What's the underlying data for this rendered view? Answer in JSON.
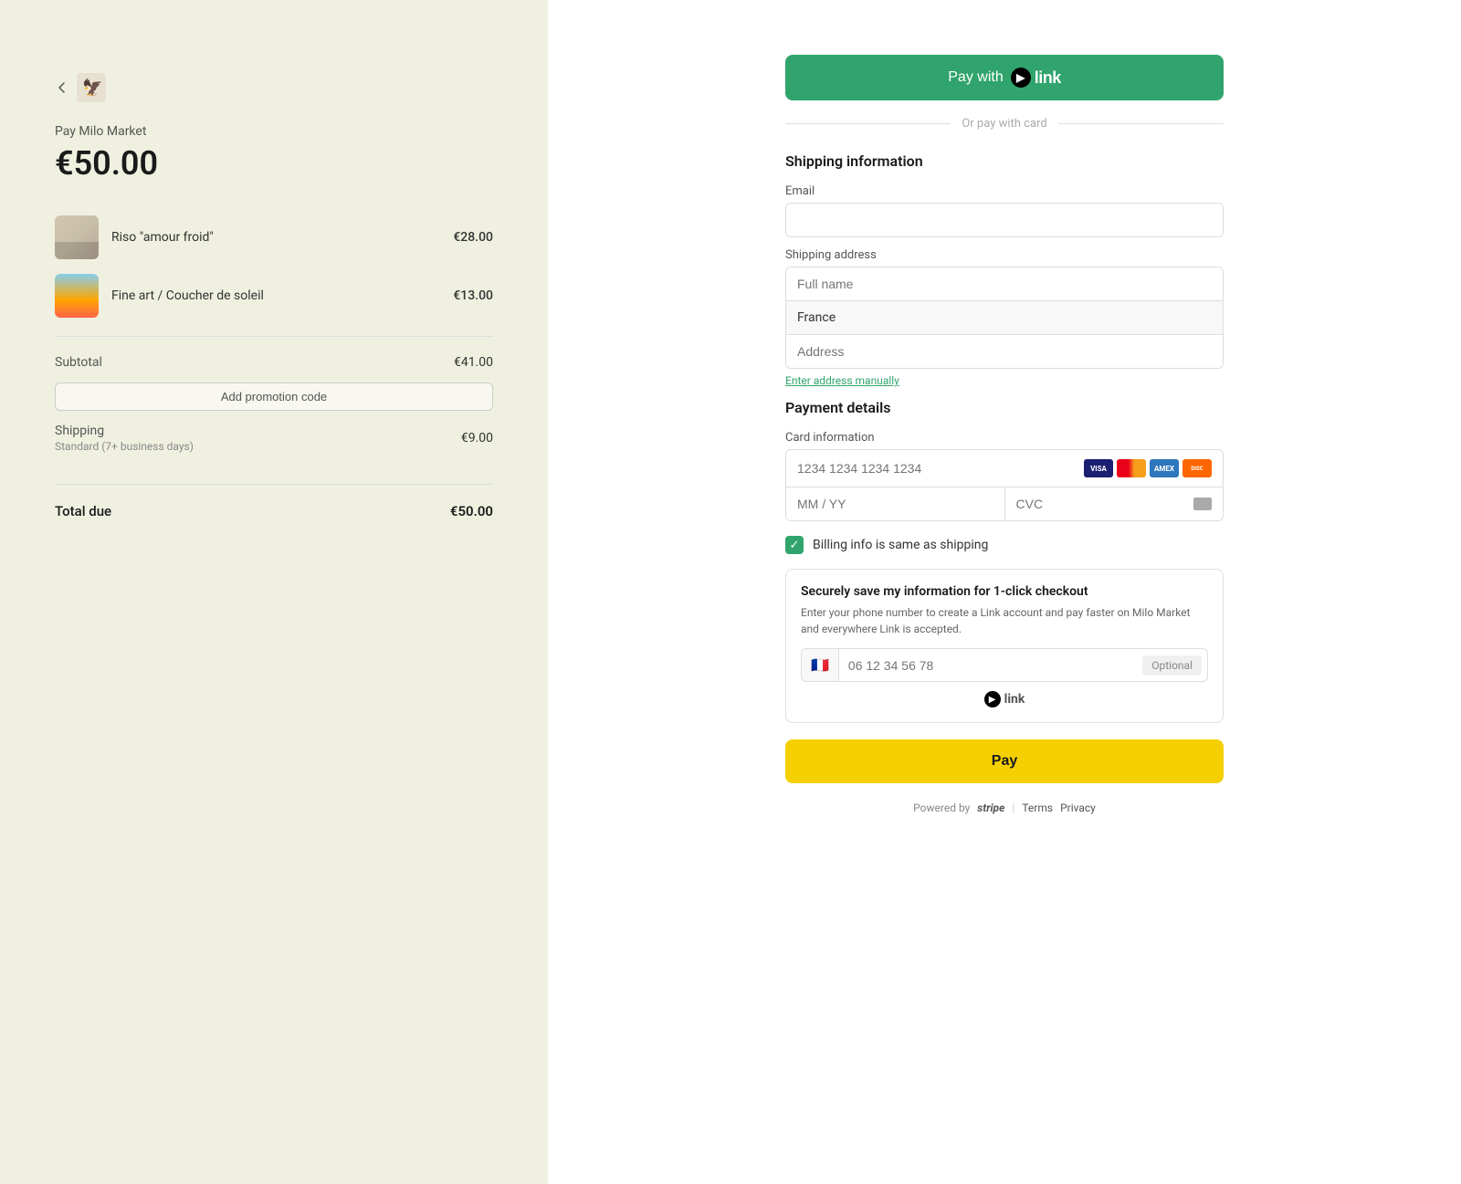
{
  "left": {
    "pay_label": "Pay Milo Market",
    "total_amount": "€50.00",
    "items": [
      {
        "name": "Riso \"amour froid\"",
        "price": "€28.00"
      },
      {
        "name": "Fine art / Coucher de soleil",
        "price": "€13.00"
      }
    ],
    "subtotal_label": "Subtotal",
    "subtotal_value": "€41.00",
    "promo_button": "Add promotion code",
    "shipping_label": "Shipping",
    "shipping_sublabel": "Standard (7+ business days)",
    "shipping_value": "€9.00",
    "total_label": "Total due",
    "total_value": "€50.00"
  },
  "right": {
    "pay_with_link_label": "Pay with",
    "link_text": "link",
    "or_pay_label": "Or pay with card",
    "shipping_section": "Shipping information",
    "email_label": "Email",
    "email_placeholder": "",
    "shipping_address_label": "Shipping address",
    "full_name_placeholder": "Full name",
    "country_value": "France",
    "address_placeholder": "Address",
    "enter_manually": "Enter address manually",
    "payment_section": "Payment details",
    "card_info_label": "Card information",
    "card_placeholder": "1234 1234 1234 1234",
    "expiry_placeholder": "MM / YY",
    "cvc_placeholder": "CVC",
    "billing_same_label": "Billing info is same as shipping",
    "save_info_title": "Securely save my information for 1-click checkout",
    "save_info_desc": "Enter your phone number to create a Link account and pay faster on Milo Market and everywhere Link is accepted.",
    "phone_flag": "🇫🇷",
    "phone_placeholder": "06 12 34 56 78",
    "optional_label": "Optional",
    "pay_button": "Pay",
    "powered_by": "Powered by",
    "stripe_label": "stripe",
    "terms_label": "Terms",
    "privacy_label": "Privacy"
  }
}
